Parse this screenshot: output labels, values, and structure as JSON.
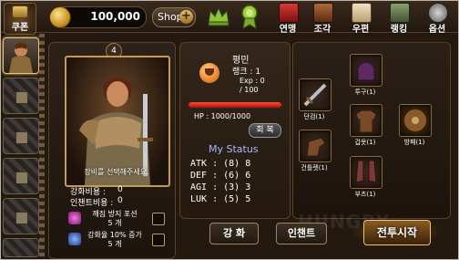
{
  "topbar": {
    "coupon_label": "쿠폰",
    "gold_amount": "100,000",
    "shop_label": "Shop",
    "shop_plus": "+",
    "nav": [
      {
        "label": "연맹",
        "icon": "banner-icon",
        "color": "#b3262a"
      },
      {
        "label": "조각",
        "icon": "book-icon",
        "color": "#8c4b25"
      },
      {
        "label": "우편",
        "icon": "letter-icon",
        "color": "#d8c49c"
      },
      {
        "label": "랭킹",
        "icon": "ranking-icon",
        "color": "#6b7e5a"
      },
      {
        "label": "옵션",
        "icon": "gear-icon",
        "color": "#9a9a9a"
      }
    ]
  },
  "hero_list": {
    "slots": [
      {
        "state": "active"
      },
      {
        "state": "locked"
      },
      {
        "state": "locked"
      },
      {
        "state": "locked"
      },
      {
        "state": "locked"
      },
      {
        "state": "locked"
      }
    ]
  },
  "character": {
    "slot_number": "4",
    "portrait_caption": "장비를 선택해주세요.",
    "enhance_cost_label": "강화비용 :",
    "enhance_cost_value": "0",
    "enchant_cost_label": "인챈트비용 :",
    "enchant_cost_value": "0",
    "items": [
      {
        "line1": "깨짐 방지 포션",
        "line2": "5 개",
        "color": "#c43db0"
      },
      {
        "line1": "강화율 10% 증가",
        "line2": "5 개",
        "color": "#4b77d8"
      }
    ]
  },
  "stats": {
    "grade": "평민",
    "rank": "랭크 : 1",
    "exp_label": "Exp : 0",
    "exp_max": "/ 100",
    "hp_text": "HP : 1000/1000",
    "hp_ratio": 1.0,
    "heal_label": "회 복",
    "title": "My Status",
    "lines": [
      "ATK : (8) 8",
      "DEF : (6) 6",
      "AGI : (3) 3",
      "LUK : (5) 5"
    ]
  },
  "equipment": {
    "slots": [
      {
        "label": "투구(1)",
        "icon": "helmet-icon",
        "color": "#6a2f6a"
      },
      {
        "label": "단검(1)",
        "icon": "dagger-icon",
        "color": "#9aa4b0"
      },
      {
        "label": "갑옷(1)",
        "icon": "armor-icon",
        "color": "#7a4a2a"
      },
      {
        "label": "방패(1)",
        "icon": "shield-icon",
        "color": "#8a5a2a"
      },
      {
        "label": "건틀렛(1)",
        "icon": "gauntlet-icon",
        "color": "#7a4a2a"
      },
      {
        "label": "부츠(1)",
        "icon": "boots-icon",
        "color": "#7a3a3a"
      }
    ]
  },
  "buttons": {
    "enhance": "강 화",
    "enchant": "인챈트",
    "battle": "전투시작"
  },
  "watermark": "HUNGRY"
}
